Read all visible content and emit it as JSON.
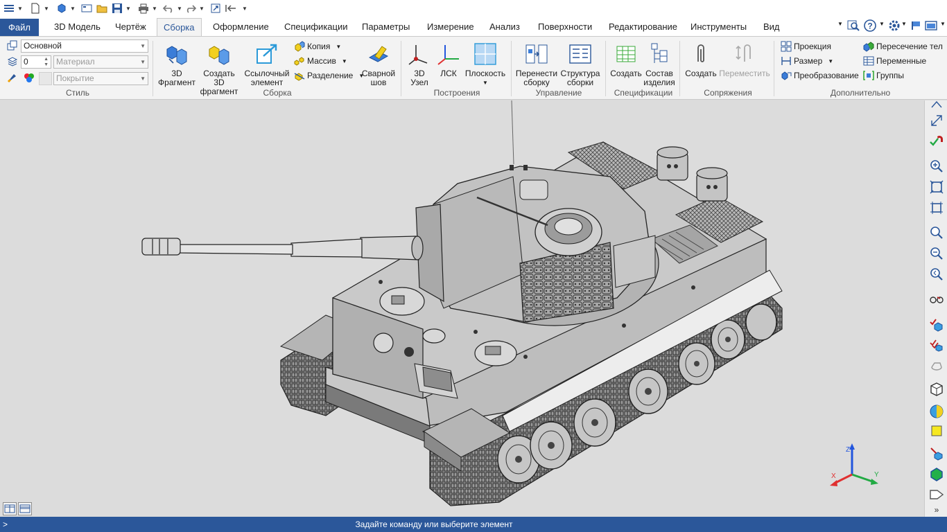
{
  "quick_access": {
    "icons": [
      "menu-icon",
      "new-document-icon",
      "new-part-icon",
      "new-drawing-icon",
      "open-icon",
      "save-icon",
      "print-icon",
      "undo-icon",
      "redo-icon",
      "rebuild-icon",
      "properties-icon",
      "customize-icon"
    ]
  },
  "tabs": [
    {
      "id": "file",
      "label": "Файл"
    },
    {
      "id": "3d-model",
      "label": "3D Модель"
    },
    {
      "id": "drawing",
      "label": "Чертёж"
    },
    {
      "id": "assembly",
      "label": "Сборка"
    },
    {
      "id": "design",
      "label": "Оформление"
    },
    {
      "id": "specs",
      "label": "Спецификации"
    },
    {
      "id": "params",
      "label": "Параметры"
    },
    {
      "id": "measure",
      "label": "Измерение"
    },
    {
      "id": "analysis",
      "label": "Анализ"
    },
    {
      "id": "surfaces",
      "label": "Поверхности"
    },
    {
      "id": "editing",
      "label": "Редактирование"
    },
    {
      "id": "tools",
      "label": "Инструменты"
    },
    {
      "id": "view",
      "label": "Вид"
    }
  ],
  "active_tab": "Сборка",
  "ribbon": {
    "style": {
      "label": "Стиль",
      "style_value": "Основной",
      "layer_value": "0",
      "material_placeholder": "Материал",
      "coating_placeholder": "Покрытие"
    },
    "assembly": {
      "label": "Сборка",
      "fragment_3d": [
        "3D",
        "Фрагмент"
      ],
      "create_fragment": [
        "Создать 3D",
        "фрагмент"
      ],
      "ref_element": [
        "Ссылочный",
        "элемент"
      ],
      "copy": "Копия",
      "array": "Массив",
      "split": "Разделение",
      "weld": [
        "Сварной",
        "шов"
      ]
    },
    "constructions": {
      "label": "Построения",
      "node_3d": [
        "3D",
        "Узел"
      ],
      "lcs": "ЛСК",
      "plane": "Плоскость"
    },
    "management": {
      "label": "Управление",
      "transfer": [
        "Перенести",
        "сборку"
      ],
      "structure": [
        "Структура",
        "сборки"
      ]
    },
    "specifications": {
      "label": "Спецификации",
      "create": "Создать",
      "composition": [
        "Состав",
        "изделия"
      ]
    },
    "mates": {
      "label": "Сопряжения",
      "create": "Создать",
      "move": "Переместить"
    },
    "additional": {
      "label": "Дополнительно",
      "projection": "Проекция",
      "size": "Размер",
      "transform": "Преобразование",
      "intersection": "Пересечение тел",
      "variables": "Переменные",
      "groups": "Группы"
    }
  },
  "right_toolbar": [
    "fit-icon",
    "dimension-icon",
    "magnet-check-icon",
    "zoom-in-icon",
    "zoom-frame-icon",
    "zoom-all-icon",
    "zoom-scale-icon",
    "zoom-out-icon",
    "zoom-previous-icon",
    "glasses-icon",
    "check-body-icon",
    "check-multi-icon",
    "rotate-icon",
    "cube-icon",
    "section-icon",
    "yellow-face-icon",
    "cut-icon",
    "green-face-icon",
    "drawing-view-icon",
    "more-icon"
  ],
  "triad": {
    "x": "X",
    "y": "Y",
    "z": "Z"
  },
  "colors": {
    "accent": "#2b579a",
    "axis_x": "#e03030",
    "axis_y": "#22aa44",
    "axis_z": "#2255dd"
  },
  "status_text": "Задайте команду или выберите элемент"
}
